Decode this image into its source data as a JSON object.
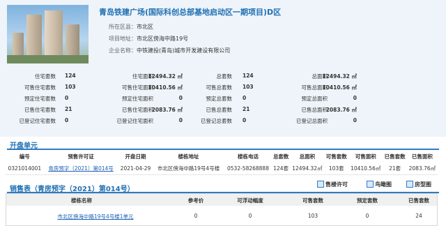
{
  "project": {
    "title": "青岛铁建广场(国际科创总部基地启动区一期项目)D区",
    "district_label": "所在区县：",
    "district": "市北区",
    "address_label": "项目地址：",
    "address": "市北区傍海中路19号",
    "company_label": "企业名称：",
    "company": "中铁建投(青岛)城市开发建设有限公司"
  },
  "stats": [
    {
      "l1": "住宅套数",
      "v1": "124",
      "l2": "住宅面积",
      "v2": "12494.32 ㎡",
      "l3": "总套数",
      "v3": "124",
      "l4": "总面积",
      "v4": "12494.32 ㎡"
    },
    {
      "l1": "可售住宅套数",
      "v1": "103",
      "l2": "可售住宅面积",
      "v2": "10410.56 ㎡",
      "l3": "可售总套数",
      "v3": "103",
      "l4": "可售总面积",
      "v4": "10410.56 ㎡"
    },
    {
      "l1": "预定住宅套数",
      "v1": "0",
      "l2": "预定住宅面积",
      "v2": "0",
      "l3": "预定总套数",
      "v3": "0",
      "l4": "预定总面积",
      "v4": "0"
    },
    {
      "l1": "已售住宅套数",
      "v1": "21",
      "l2": "已售住宅面积",
      "v2": "2083.76 ㎡",
      "l3": "已售总套数",
      "v3": "21",
      "l4": "已售总面积",
      "v4": "2083.76 ㎡"
    },
    {
      "l1": "已登记住宅套数",
      "v1": "0",
      "l2": "已登记住宅面积",
      "v2": "0",
      "l3": "已登记总套数",
      "v3": "0",
      "l4": "已登记总面积",
      "v4": "0"
    }
  ],
  "open_units": {
    "title": "开盘单元",
    "headers": [
      "编号",
      "预售许可证",
      "开盘日期",
      "楼栋地址",
      "楼栋电话",
      "总套数",
      "总面积",
      "可售套数",
      "可售面积",
      "已售套数",
      "已售面积"
    ],
    "row": [
      "0321014001",
      "青房预字（2021）第014号",
      "2021-04-29",
      "市北区傍海中路19号4号楼",
      "0532-58268888",
      "124套",
      "12494.32㎡",
      "103套",
      "10410.56㎡",
      "21套",
      "2083.76㎡"
    ]
  },
  "sales": {
    "title": "销售表（青房预字（2021）第014号）",
    "tool_permit": "售楼许可",
    "tool_aerial": "鸟瞰图",
    "tool_layout": "房型图",
    "headers": [
      "楼栋名称",
      "参考价",
      "可浮动幅度",
      "可售套数",
      "预定套数",
      "已售套数"
    ],
    "row": [
      "市北区傍海中路19号4号楼1单元",
      "0",
      "0",
      "103",
      "0",
      "24"
    ]
  },
  "colors": {
    "title_blue": "#1f6fb2",
    "rule_blue": "#2e7bc4",
    "top_bg": "#eef4fa"
  }
}
